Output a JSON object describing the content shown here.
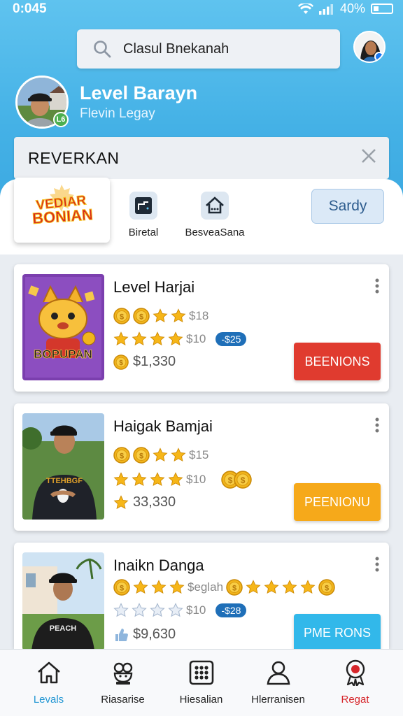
{
  "status": {
    "time": "0:045",
    "battery": "40%"
  },
  "search": {
    "text": "Clasul Bnekanah"
  },
  "profile": {
    "name": "Level Barayn",
    "subtitle": "Flevin Legay",
    "badge": "L6"
  },
  "banner": {
    "title": "REVERKAN"
  },
  "logo": {
    "line1": "VEDIAR",
    "line2": "BONIAN"
  },
  "nav": [
    {
      "label": "Biretal",
      "icon": "tap-icon"
    },
    {
      "label": "BesveaSana",
      "icon": "house-icon"
    }
  ],
  "sardy_button": "Sardy",
  "cards": [
    {
      "title": "Level Harjai",
      "row1_value": "$18",
      "row2_value": "$10",
      "row2_pill": "-$25",
      "amount": "$1,330",
      "button": "BEENIONS",
      "button_color": "#e03b2f",
      "thumb_text": "BOPUPAN"
    },
    {
      "title": "Haigak Bamjai",
      "row1_value": "$15",
      "row2_value": "$10",
      "amount": "33,330",
      "button": "PEENIONU",
      "button_color": "#f6a91a"
    },
    {
      "title": "Inaikn Danga",
      "row1_value": "$eglah",
      "row2_value": "$10",
      "row2_pill": "-$28",
      "amount": "$9,630",
      "button": "PME RONS",
      "button_color": "#32b8ea"
    }
  ],
  "bottom_nav": [
    {
      "label": "Levals",
      "icon": "home-icon",
      "active": true
    },
    {
      "label": "Riasarise",
      "icon": "chef-icon"
    },
    {
      "label": "Hiesalian",
      "icon": "grid-icon"
    },
    {
      "label": "Hlerranisen",
      "icon": "person-icon"
    },
    {
      "label": "Regat",
      "icon": "award-icon"
    }
  ],
  "colors": {
    "accent": "#3aa7e0",
    "active_tab": "#2196d3",
    "regat": "#d6262b"
  }
}
